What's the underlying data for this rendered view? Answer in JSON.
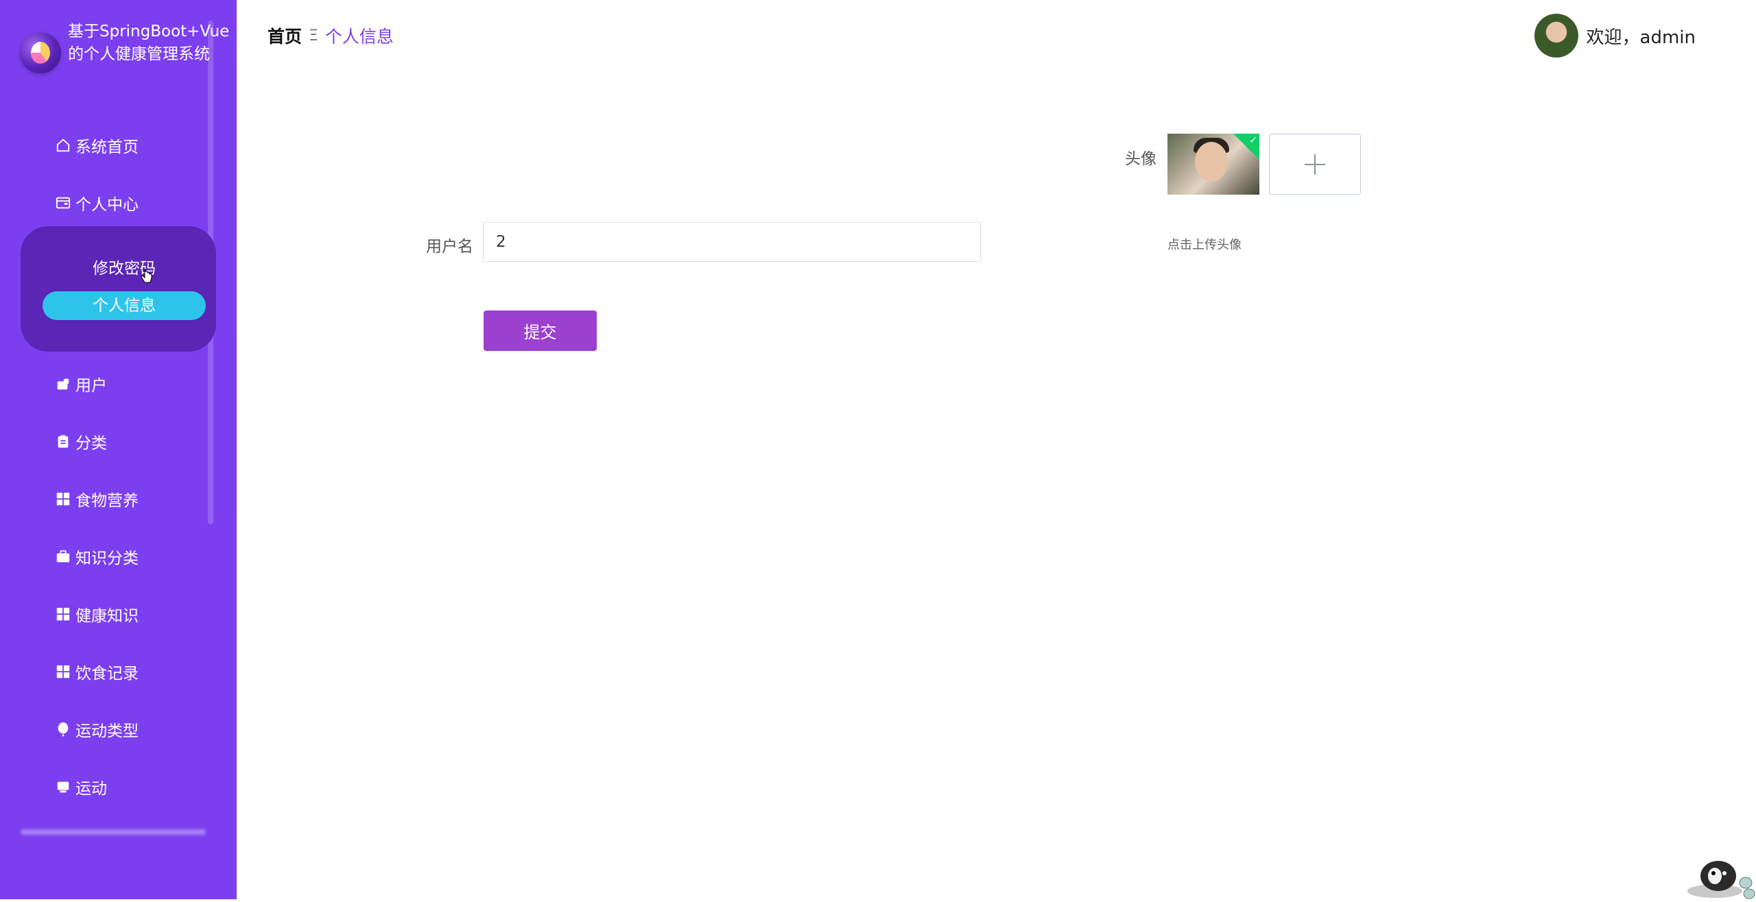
{
  "sidebar": {
    "brand_title": "基于SpringBoot+Vue的个人健康管理系统",
    "items": [
      {
        "label": "系统首页",
        "icon": "home-icon"
      },
      {
        "label": "个人中心",
        "icon": "wallet-icon"
      },
      {
        "label": "用户",
        "icon": "user-card-icon"
      },
      {
        "label": "分类",
        "icon": "clipboard-icon"
      },
      {
        "label": "食物营养",
        "icon": "grid-icon"
      },
      {
        "label": "知识分类",
        "icon": "briefcase-icon"
      },
      {
        "label": "健康知识",
        "icon": "grid-icon"
      },
      {
        "label": "饮食记录",
        "icon": "grid-icon"
      },
      {
        "label": "运动类型",
        "icon": "balloon-icon"
      },
      {
        "label": "运动",
        "icon": "monitor-icon"
      }
    ],
    "submenu": [
      {
        "label": "修改密码",
        "active": false
      },
      {
        "label": "个人信息",
        "active": true
      }
    ]
  },
  "header": {
    "breadcrumb_home": "首页",
    "breadcrumb_separator": "Ξ",
    "breadcrumb_current": "个人信息",
    "welcome_text": "欢迎，admin"
  },
  "form": {
    "avatar_label": "头像",
    "upload_hint": "点击上传头像",
    "username_label": "用户名",
    "username_value": "2",
    "submit_label": "提交"
  },
  "colors": {
    "sidebar_bg": "#7c3ff0",
    "submenu_bg": "#5b25b5",
    "active_item": "#2ec4ea",
    "submit_bg": "#9b40cf",
    "breadcrumb_current": "#7c3ff0"
  }
}
